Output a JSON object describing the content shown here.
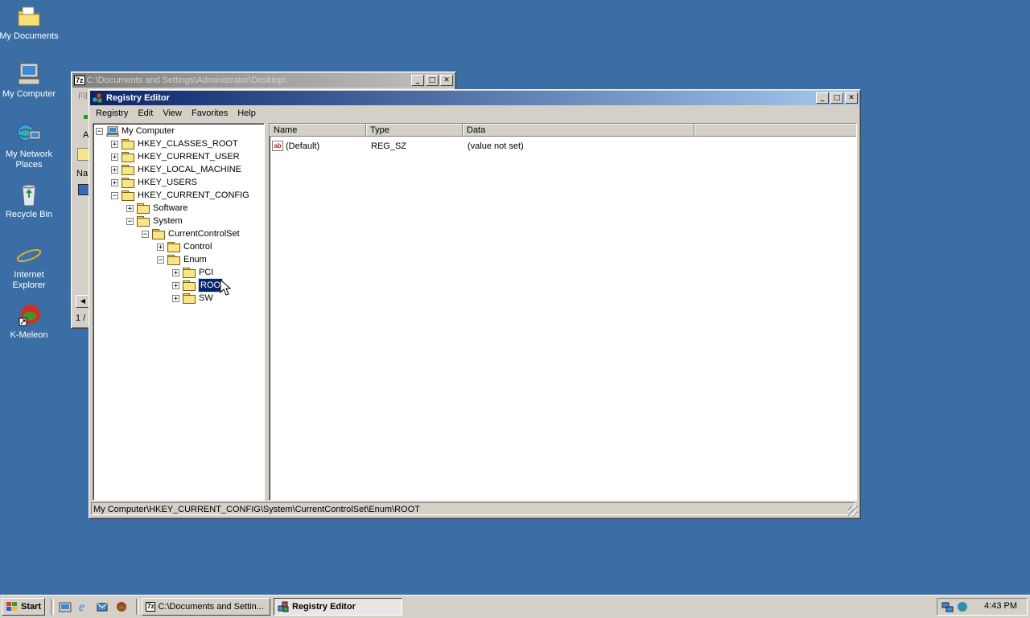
{
  "desktop": {
    "icons": [
      {
        "label": "My Documents",
        "icon": "my-documents-icon"
      },
      {
        "label": "My Computer",
        "icon": "my-computer-icon"
      },
      {
        "label": "My Network Places",
        "icon": "network-places-icon"
      },
      {
        "label": "Recycle Bin",
        "icon": "recycle-bin-icon"
      },
      {
        "label": "Internet Explorer",
        "icon": "internet-explorer-icon"
      },
      {
        "label": "K-Meleon",
        "icon": "k-meleon-icon"
      }
    ]
  },
  "sevenzip": {
    "badge": "7z",
    "title": "C:\\Documents and Settings\\Administrator\\Desktop\\",
    "menu_first": "Fil",
    "toolbar_a": "A",
    "col_name": "Na",
    "status": "1 /"
  },
  "regedit": {
    "title": "Registry Editor",
    "menu": [
      "Registry",
      "Edit",
      "View",
      "Favorites",
      "Help"
    ],
    "tree": [
      {
        "label": "My Computer",
        "expander": "−"
      },
      {
        "label": "HKEY_CLASSES_ROOT",
        "expander": "+"
      },
      {
        "label": "HKEY_CURRENT_USER",
        "expander": "+"
      },
      {
        "label": "HKEY_LOCAL_MACHINE",
        "expander": "+"
      },
      {
        "label": "HKEY_USERS",
        "expander": "+"
      },
      {
        "label": "HKEY_CURRENT_CONFIG",
        "expander": "−"
      },
      {
        "label": "Software",
        "expander": "+"
      },
      {
        "label": "System",
        "expander": "−"
      },
      {
        "label": "CurrentControlSet",
        "expander": "−"
      },
      {
        "label": "Control",
        "expander": "+"
      },
      {
        "label": "Enum",
        "expander": "−"
      },
      {
        "label": "PCI",
        "expander": "+"
      },
      {
        "label": "ROO",
        "expander": "+",
        "selected": true
      },
      {
        "label": "SW",
        "expander": "+"
      }
    ],
    "columns": {
      "name": "Name",
      "type": "Type",
      "data": "Data"
    },
    "values": [
      {
        "name": "(Default)",
        "type": "REG_SZ",
        "data": "(value not set)"
      }
    ],
    "status": "My Computer\\HKEY_CURRENT_CONFIG\\System\\CurrentControlSet\\Enum\\ROOT"
  },
  "taskbar": {
    "start": "Start",
    "tasks": [
      {
        "label": "C:\\Documents and Settin...",
        "active": false
      },
      {
        "label": "Registry Editor",
        "active": true
      }
    ],
    "clock": "4:43 PM"
  },
  "colors": {
    "desktop": "#3a6ea5",
    "titlebar_active": "#0a246a",
    "selection": "#0a246a"
  }
}
